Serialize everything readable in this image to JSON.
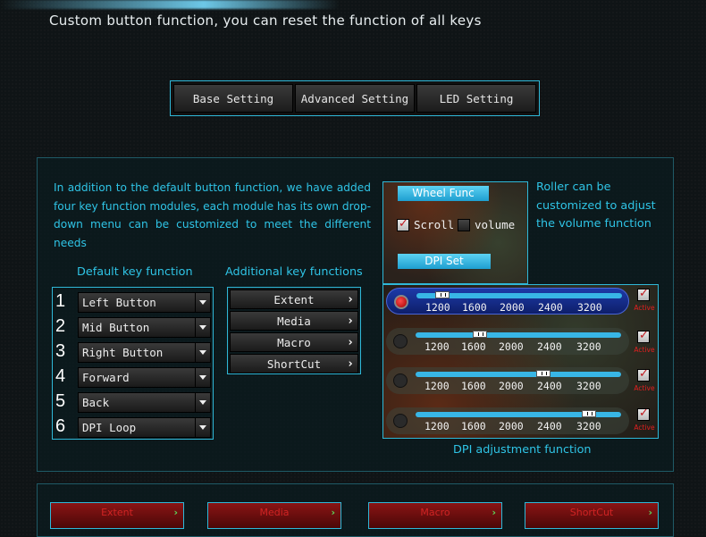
{
  "header": {
    "subtitle": "Custom button function, you can reset the function of all keys"
  },
  "tabs": [
    "Base Setting",
    "Advanced Setting",
    "LED Setting"
  ],
  "intro": "In addition to the default button function, we have added four key function modules, each module has its own drop-down menu can be customized to meet the different needs",
  "default_keys": {
    "heading": "Default key function",
    "items": [
      {
        "num": "1",
        "label": "Left Button"
      },
      {
        "num": "2",
        "label": "Mid Button"
      },
      {
        "num": "3",
        "label": "Right Button"
      },
      {
        "num": "4",
        "label": "Forward"
      },
      {
        "num": "5",
        "label": "Back"
      },
      {
        "num": "6",
        "label": "DPI Loop"
      }
    ]
  },
  "additional_keys": {
    "heading": "Additional key functions",
    "items": [
      "Extent",
      "Media",
      "Macro",
      "ShortCut"
    ]
  },
  "wheel": {
    "title": "Wheel Func",
    "scroll_label": "Scroll",
    "scroll_checked": true,
    "volume_label": "volume",
    "volume_checked": false
  },
  "roller_text": "Roller can be customized to adjust the volume function",
  "dpi": {
    "title": "DPI Set",
    "ticks": [
      "1200",
      "1600",
      "2000",
      "2400",
      "3200"
    ],
    "active_label": "Active",
    "caption": "DPI adjustment function",
    "rows": [
      {
        "selected": true,
        "level_fraction": 0.1,
        "active": true
      },
      {
        "selected": false,
        "level_fraction": 0.3,
        "active": true
      },
      {
        "selected": false,
        "level_fraction": 0.63,
        "active": true
      },
      {
        "selected": false,
        "level_fraction": 0.87,
        "active": true
      }
    ]
  },
  "bottom_buttons": [
    "Extent",
    "Media",
    "Macro",
    "ShortCut"
  ],
  "colors": {
    "accent": "#2fc4e6",
    "border": "#2fb8d8",
    "active_red": "#e02020"
  }
}
